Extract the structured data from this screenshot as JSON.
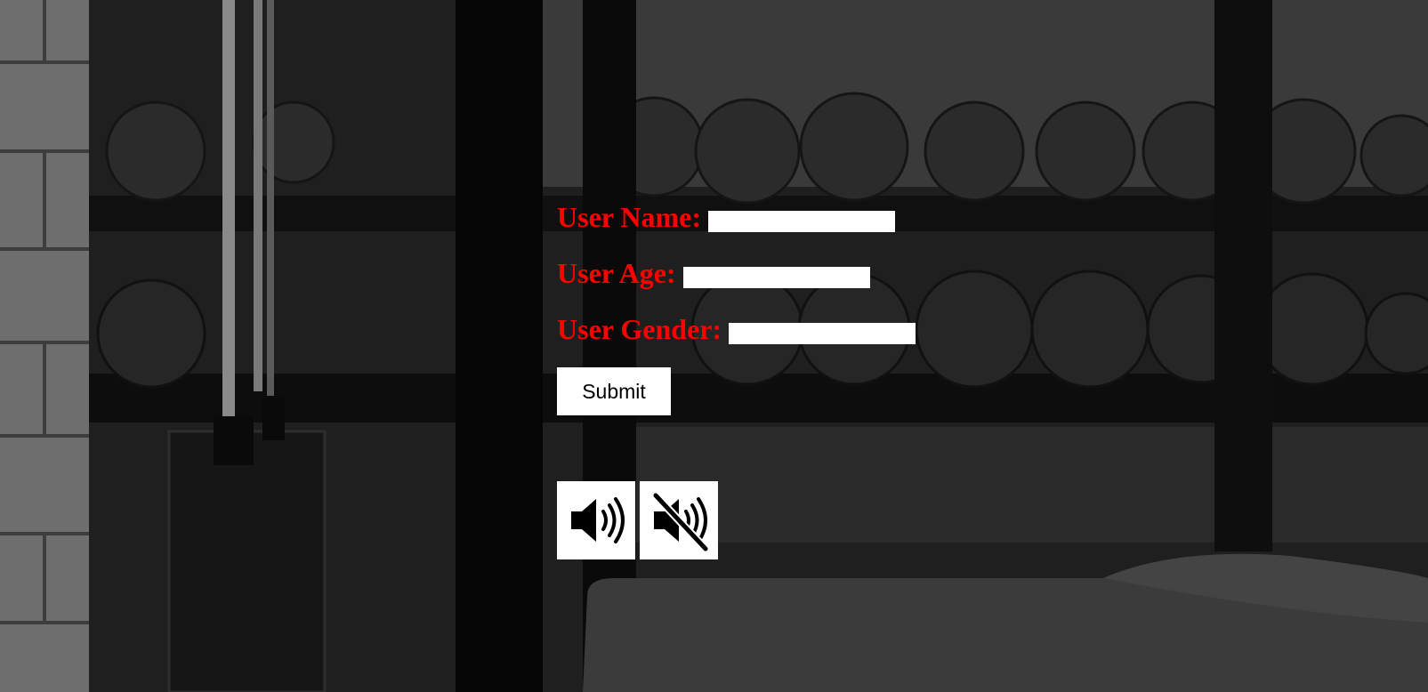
{
  "form": {
    "fields": [
      {
        "label": "User Name:",
        "value": "",
        "placeholder": ""
      },
      {
        "label": "User Age:",
        "value": "",
        "placeholder": ""
      },
      {
        "label": "User Gender:",
        "value": "",
        "placeholder": ""
      }
    ],
    "submit_label": "Submit"
  },
  "sound_controls": {
    "icons": [
      "speaker-on-icon",
      "speaker-muted-icon"
    ]
  },
  "colors": {
    "label": "#ff0000",
    "input_bg": "#ffffff",
    "button_bg": "#ffffff",
    "background": "#1a1a1a"
  },
  "background_image": {
    "subject": "grayscale gym interior with dumbbell rack and bench"
  }
}
